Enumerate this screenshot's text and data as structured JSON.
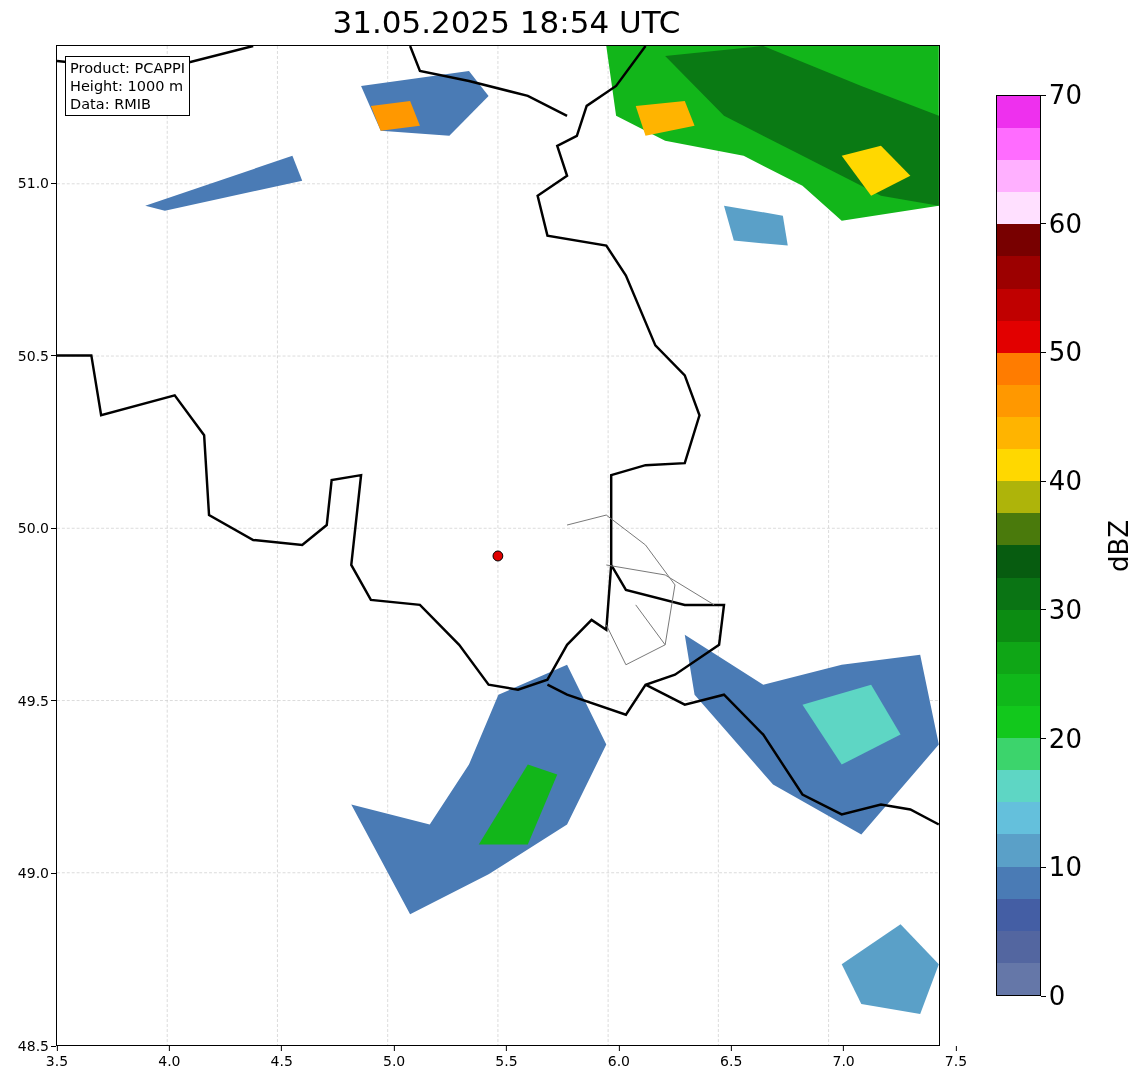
{
  "title": "31.05.2025 18:54 UTC",
  "info_box": [
    "Product: PCAPPI",
    "Height: 1000 m",
    "Data: RMIB"
  ],
  "x_axis": {
    "ticks": [
      "3.5",
      "4.0",
      "4.5",
      "5.0",
      "5.5",
      "6.0",
      "6.5",
      "7.0",
      "7.5"
    ]
  },
  "y_axis": {
    "ticks": [
      "51.0",
      "50.5",
      "50.0",
      "49.5",
      "49.0",
      "48.5"
    ]
  },
  "colorbar": {
    "label": "dBZ",
    "ticks": [
      "70",
      "60",
      "50",
      "40",
      "30",
      "20",
      "10",
      "0"
    ],
    "segments": [
      {
        "color": "#6577a8"
      },
      {
        "color": "#5366a0"
      },
      {
        "color": "#445ea4"
      },
      {
        "color": "#4a7bb5"
      },
      {
        "color": "#5aa0c8"
      },
      {
        "color": "#64c0dc"
      },
      {
        "color": "#5ed6c4"
      },
      {
        "color": "#3cd46c"
      },
      {
        "color": "#12c81c"
      },
      {
        "color": "#10b81a"
      },
      {
        "color": "#0fa616"
      },
      {
        "color": "#0c8c12"
      },
      {
        "color": "#0a7414"
      },
      {
        "color": "#075c10"
      },
      {
        "color": "#4a7a0c"
      },
      {
        "color": "#aeb40a"
      },
      {
        "color": "#ffd800"
      },
      {
        "color": "#ffb400"
      },
      {
        "color": "#ff9800"
      },
      {
        "color": "#ff7c00"
      },
      {
        "color": "#e20000"
      },
      {
        "color": "#c00000"
      },
      {
        "color": "#9c0000"
      },
      {
        "color": "#780000"
      },
      {
        "color": "#ffe0ff"
      },
      {
        "color": "#ffb0ff"
      },
      {
        "color": "#ff6cff"
      },
      {
        "color": "#ee30ee"
      }
    ]
  }
}
